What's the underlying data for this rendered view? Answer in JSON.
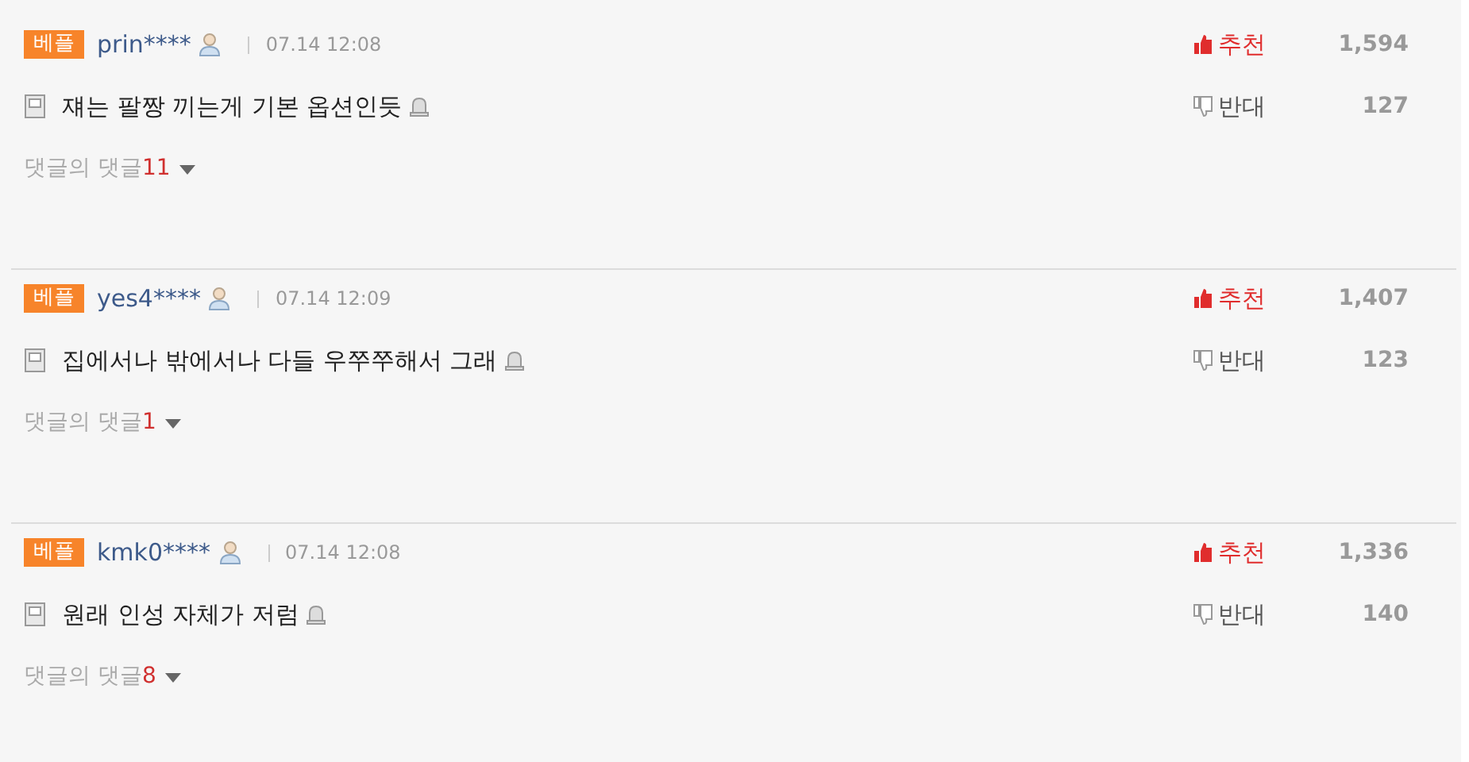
{
  "comments": [
    {
      "badge": "베플",
      "user": "prin****",
      "time": "07.14 12:08",
      "text": "쟤는 팔짱 끼는게 기본 옵션인듯",
      "up_label": "추천",
      "up_count": "1,594",
      "down_label": "반대",
      "down_count": "127",
      "replies_label": "댓글의 댓글",
      "replies_count": "11"
    },
    {
      "badge": "베플",
      "user": "yes4****",
      "time": "07.14 12:09",
      "text": "집에서나 밖에서나 다들 우쭈쭈해서 그래",
      "up_label": "추천",
      "up_count": "1,407",
      "down_label": "반대",
      "down_count": "123",
      "replies_label": "댓글의 댓글",
      "replies_count": "1"
    },
    {
      "badge": "베플",
      "user": "kmk0****",
      "time": "07.14 12:08",
      "text": "원래 인성 자체가 저럼",
      "up_label": "추천",
      "up_count": "1,336",
      "down_label": "반대",
      "down_count": "140",
      "replies_label": "댓글의 댓글",
      "replies_count": "8"
    }
  ]
}
